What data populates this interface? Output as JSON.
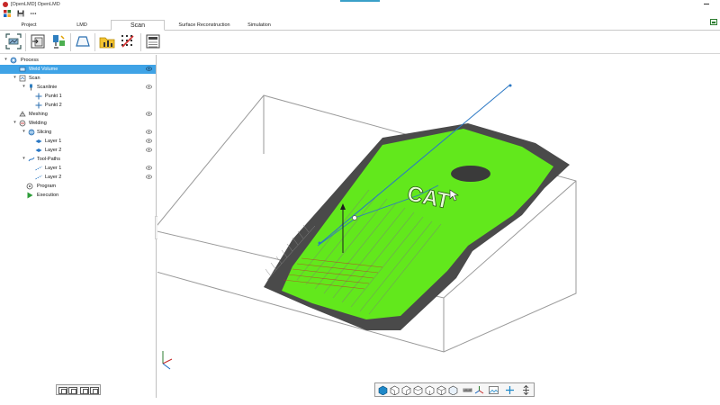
{
  "window": {
    "title": "[OpenLMD] OpenLMD"
  },
  "tabs": [
    {
      "label": "Project"
    },
    {
      "label": "LMD"
    },
    {
      "label": "Scan"
    },
    {
      "label": "Surface Reconstruction"
    },
    {
      "label": "Simulation"
    }
  ],
  "active_tab": "Scan",
  "ribbon": [
    {
      "icon": "scan-frame-icon"
    },
    {
      "icon": "import-icon"
    },
    {
      "icon": "sensor-icon"
    },
    {
      "icon": "trapezoid-icon"
    },
    {
      "icon": "folder-chart-icon"
    },
    {
      "icon": "grid-dots-icon"
    },
    {
      "icon": "save-panel-icon"
    }
  ],
  "tree": [
    {
      "label": "Process",
      "icon": "process-icon"
    },
    {
      "label": "Weld Volume",
      "icon": "volume-icon",
      "selected": true,
      "eye": true
    },
    {
      "label": "Scan",
      "icon": "scan-icon"
    },
    {
      "label": "Scanlinie",
      "icon": "scanline-icon",
      "eye": true
    },
    {
      "label": "Punkt 1",
      "icon": "point-icon"
    },
    {
      "label": "Punkt 2",
      "icon": "point-icon"
    },
    {
      "label": "Meshing",
      "icon": "meshing-icon",
      "eye": true
    },
    {
      "label": "Welding",
      "icon": "welding-icon"
    },
    {
      "label": "Slicing",
      "icon": "slicing-icon",
      "eye": true
    },
    {
      "label": "Layer 1",
      "icon": "layer-icon",
      "eye": true
    },
    {
      "label": "Layer 2",
      "icon": "layer-icon",
      "eye": true
    },
    {
      "label": "Tool-Paths",
      "icon": "toolpath-icon"
    },
    {
      "label": "Layer 1",
      "icon": "path-layer-icon",
      "eye": true
    },
    {
      "label": "Layer 2",
      "icon": "path-layer-icon",
      "eye": true
    },
    {
      "label": "Program",
      "icon": "program-icon"
    },
    {
      "label": "Execution",
      "icon": "execution-icon"
    }
  ],
  "scene": {
    "model_text": "CAT"
  },
  "colors": {
    "accent": "#3fa3e6",
    "mesh_green": "#62e81c",
    "mesh_gray": "#4a4a4a",
    "bounding_box": "#9a9a9a",
    "path_blue": "#2b78c4"
  }
}
